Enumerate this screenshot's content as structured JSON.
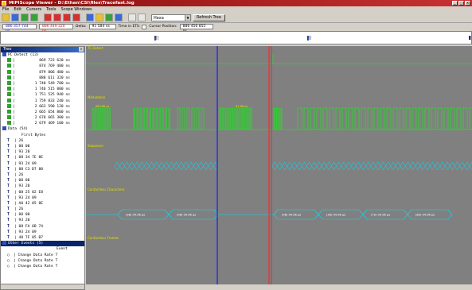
{
  "window": {
    "title": "MIPIScope Viewer - D:\\Ethan\\CSI\\files\\Tracefast.log"
  },
  "menu": [
    "File",
    "Edit",
    "Cursors",
    "Tools",
    "Scope Windows"
  ],
  "toolbar": {
    "view_mode": "Hexa",
    "refresh_label": "Refresh Tree"
  },
  "status": {
    "cursor1": "886 357 744 ns",
    "cursor2": "886 449 320 ns",
    "delta_label": "Delta:",
    "delta": "91 584 ns",
    "etu_label": "Time in ETU",
    "position_label": "Cursor Position:",
    "position": "886 456 855 ns"
  },
  "overview": {
    "labels": [
      "|||",
      "|||",
      "|||"
    ]
  },
  "tree": {
    "title": "Tree",
    "group1": "PC Detect (13)",
    "times": [
      "869 723 620 ns",
      "874 769 480 ns",
      "879 806 480 ns",
      "888 611 320 ns",
      "1 740 549 780 ns",
      "1 746 515 800 ns",
      "1 751 525 940 ns",
      "1 759 833 240 ns",
      "2 663 590 120 ns",
      "2 665 654 800 ns",
      "2 670 665 300 ns",
      "2 679 469 100 ns"
    ],
    "group2": "Data (54)",
    "first_bytes_label": "First Bytes",
    "bytes": [
      "26",
      "00 00",
      "93 20",
      "08 34 7E 8E",
      "93 24 09",
      "80 C3 D7 80",
      "26",
      "00 00",
      "93 20",
      "08 25 02 E8",
      "93 24 09",
      "A0 42 05 8E",
      "26",
      "00 00",
      "93 20",
      "08 FA 6B 74",
      "93 24 09",
      "40 7F 05 B7"
    ],
    "group3": "Other Events (5)",
    "event_label": "Event",
    "events": [
      "Change Data Rate T",
      "Change Data Rate T",
      "Change Data Rate T"
    ]
  },
  "channels": [
    "TC Detect",
    "Modulation",
    "Sequence",
    "Contactless Characters",
    "Contactless Frames"
  ],
  "wave_labels": {
    "mod1": "869.88 µs",
    "mod2": "61.88 µs",
    "chars": [
      "(98) 94.96 µs",
      "(08) 94.96 µs",
      "(08) 94.96 µs",
      "(36) 94.96 µs",
      "(7E) 94.96 µs",
      "(8E) 94.96 µs"
    ]
  },
  "colors": {
    "signal": "#00ff00",
    "label": "#e0e000",
    "cursor_blue": "#1a1aff",
    "cursor_red": "#ff2020",
    "bg": "#808080"
  }
}
